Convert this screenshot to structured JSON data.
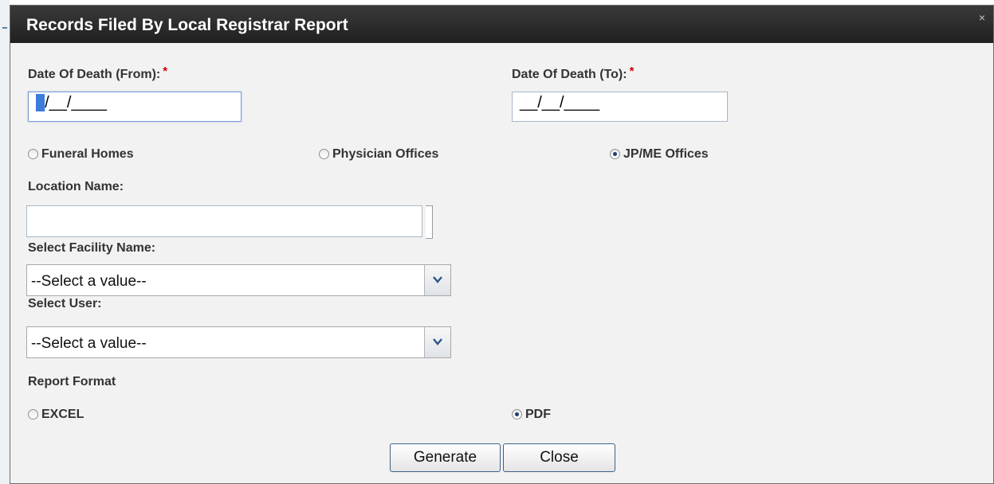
{
  "dialog": {
    "title": "Records Filed By Local Registrar Report",
    "close_glyph": "×"
  },
  "date_from": {
    "label": "Date Of Death (From):",
    "required_mark": "*",
    "value_prefix": "_",
    "value_rest": "/__/____"
  },
  "date_to": {
    "label": "Date Of Death (To):",
    "required_mark": "*",
    "value": "__/__/____"
  },
  "location_type": {
    "options": [
      {
        "label": "Funeral Homes",
        "selected": false
      },
      {
        "label": "Physician Offices",
        "selected": false
      },
      {
        "label": "JP/ME Offices",
        "selected": true
      }
    ]
  },
  "location_name": {
    "label": "Location Name:",
    "value": ""
  },
  "facility": {
    "label": "Select Facility Name:",
    "selected": "--Select a value--"
  },
  "user": {
    "label": "Select User:",
    "selected": "--Select a value--"
  },
  "report_format": {
    "label": "Report Format",
    "options": [
      {
        "label": "EXCEL",
        "selected": false
      },
      {
        "label": "PDF",
        "selected": true
      }
    ]
  },
  "buttons": {
    "generate": "Generate",
    "close": "Close"
  },
  "icons": {
    "dropdown": "chevron-down-icon",
    "close": "close-icon"
  },
  "colors": {
    "titlebar": "#2b2b2b",
    "required": "#cc0000",
    "button_border": "#3d5f8a"
  }
}
